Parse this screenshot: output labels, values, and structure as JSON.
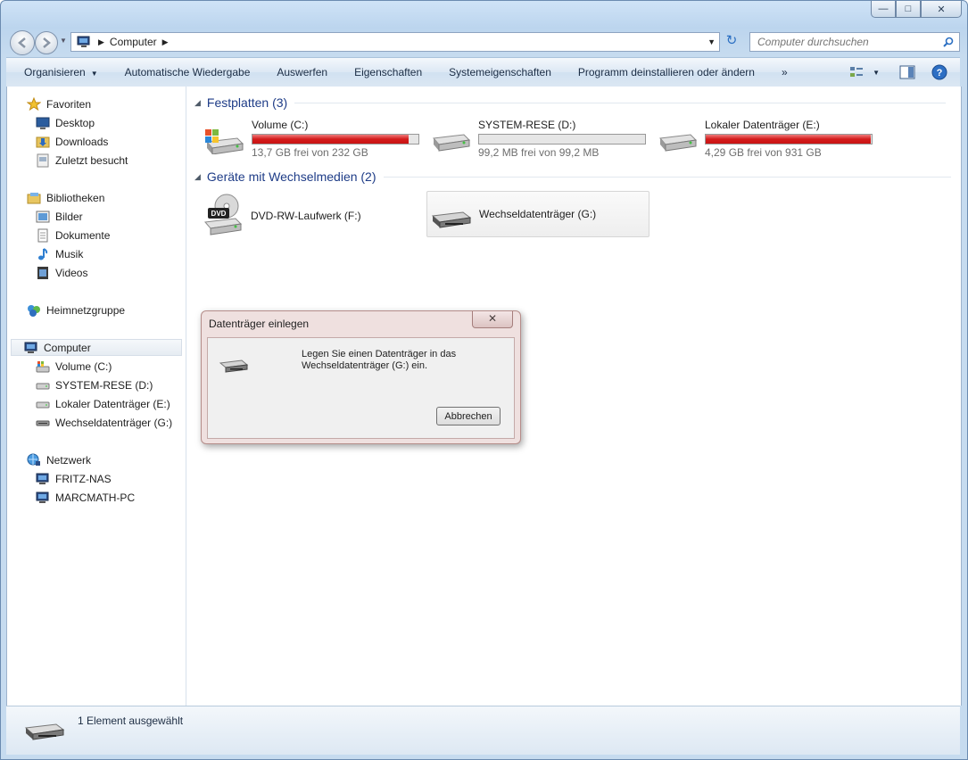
{
  "window": {
    "caption_buttons": [
      "—",
      "□",
      "✕"
    ]
  },
  "address_bar": {
    "crumb": "Computer",
    "search_placeholder": "Computer durchsuchen"
  },
  "toolbar": {
    "items": [
      {
        "label": "Organisieren",
        "has_dropdown": true
      },
      {
        "label": "Automatische Wiedergabe"
      },
      {
        "label": "Auswerfen"
      },
      {
        "label": "Eigenschaften"
      },
      {
        "label": "Systemeigenschaften"
      },
      {
        "label": "Programm deinstallieren oder ändern"
      }
    ],
    "overflow": "»"
  },
  "nav": {
    "favorites": {
      "label": "Favoriten",
      "items": [
        "Desktop",
        "Downloads",
        "Zuletzt besucht"
      ]
    },
    "libraries": {
      "label": "Bibliotheken",
      "items": [
        "Bilder",
        "Dokumente",
        "Musik",
        "Videos"
      ]
    },
    "homegroup": {
      "label": "Heimnetzgruppe"
    },
    "computer": {
      "label": "Computer",
      "items": [
        "Volume (C:)",
        "SYSTEM-RESE (D:)",
        "Lokaler Datenträger (E:)",
        "Wechseldatenträger (G:)"
      ]
    },
    "network": {
      "label": "Netzwerk",
      "items": [
        "FRITZ-NAS",
        "MARCMATH-PC"
      ]
    }
  },
  "main": {
    "hard_disks": {
      "header": "Festplatten (3)",
      "drives": [
        {
          "name": "Volume (C:)",
          "free": "13,7 GB frei von 232 GB",
          "used_fraction": 0.94
        },
        {
          "name": "SYSTEM-RESE (D:)",
          "free": "99,2 MB frei von 99,2 MB",
          "used_fraction": 0.0
        },
        {
          "name": "Lokaler Datenträger (E:)",
          "free": "4,29 GB frei von 931 GB",
          "used_fraction": 0.995
        }
      ]
    },
    "removable": {
      "header": "Geräte mit Wechselmedien (2)",
      "drives": [
        {
          "name": "DVD-RW-Laufwerk (F:)"
        },
        {
          "name": "Wechseldatenträger (G:)"
        }
      ]
    }
  },
  "dialog": {
    "title": "Datenträger einlegen",
    "message": "Legen Sie einen Datenträger in das Wechseldatenträger (G:) ein.",
    "cancel_label": "Abbrechen"
  },
  "details": {
    "text": "1 Element ausgewählt"
  }
}
